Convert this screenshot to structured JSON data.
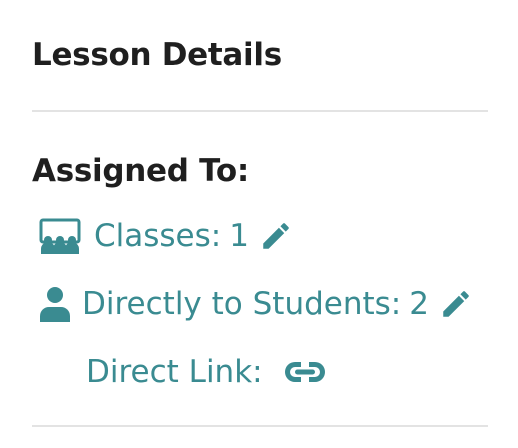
{
  "theme": {
    "accent": "#3a8b91",
    "text": "#1f1f1f",
    "divider": "#e3e3e3"
  },
  "panel": {
    "title": "Lesson Details"
  },
  "assigned": {
    "heading": "Assigned To:",
    "classes": {
      "icon": "classroom-icon",
      "label": "Classes:",
      "count": "1",
      "edit_icon": "pencil-icon"
    },
    "students": {
      "icon": "user-icon",
      "label": "Directly to Students:",
      "count": "2",
      "edit_icon": "pencil-icon"
    },
    "direct_link": {
      "label": "Direct Link:",
      "icon": "link-icon"
    }
  }
}
